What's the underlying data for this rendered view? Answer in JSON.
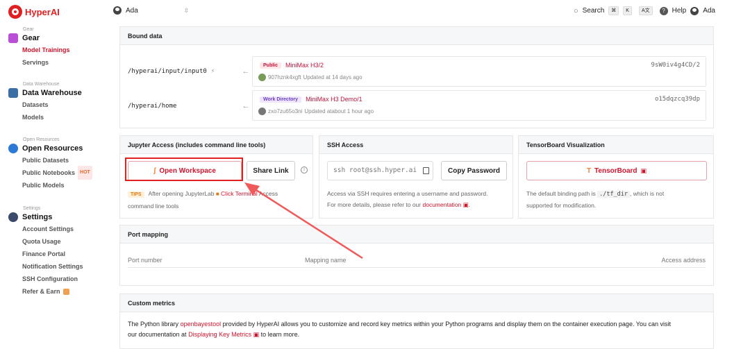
{
  "brand": {
    "name": "HyperAI"
  },
  "topbar": {
    "user": "Ada",
    "search_label": "Search",
    "kbd_cmd": "⌘",
    "kbd_k": "K",
    "help_label": "Help",
    "right_user": "Ada"
  },
  "sidebar": {
    "gear": {
      "small": "Gear",
      "title": "Gear",
      "items": [
        "Model Trainings",
        "Servings"
      ]
    },
    "warehouse": {
      "small": "Data Warehouse",
      "title": "Data Warehouse",
      "items": [
        "Datasets",
        "Models"
      ]
    },
    "resources": {
      "small": "Open Resources",
      "title": "Open Resources",
      "items": [
        "Public Datasets",
        "Public Notebooks",
        "Public Models"
      ],
      "hot": "HOT"
    },
    "settings": {
      "small": "Settings",
      "title": "Settings",
      "items": [
        "Account Settings",
        "Quota Usage",
        "Finance Portal",
        "Notification Settings",
        "SSH Configuration",
        "Refer & Earn"
      ]
    }
  },
  "bound": {
    "title": "Bound data",
    "rows": [
      {
        "path": "/hyperai/input/input0",
        "tag": "Public",
        "name": "MiniMax H3/2",
        "hash": "9sW0iv4g4CD/2",
        "user": "907hznk4xgft",
        "updated": "Updated at 14 days ago"
      },
      {
        "path": "/hyperai/home",
        "tag": "Work Directory",
        "name": "MiniMax H3 Demo/1",
        "hash": "o15dqzcq39dp",
        "user": "zxo7zu65o3ni",
        "updated": "Updated atabout 1 hour ago"
      }
    ]
  },
  "jupyter": {
    "title": "Jupyter Access (includes command line tools)",
    "open_label": "Open Workspace",
    "share_label": "Share Link",
    "tips_label": "TIPS",
    "tip_text_1": "After opening JupyterLab",
    "tip_link": "Click Terminal",
    "tip_text_2": "Access",
    "tip_text_3": "command line tools"
  },
  "ssh": {
    "title": "SSH Access",
    "command": "ssh root@ssh.hyper.ai",
    "copy_label": "Copy Password",
    "desc_1": "Access via SSH requires entering a username and password.",
    "desc_2": "For more details, please refer to our",
    "doc_link": "documentation"
  },
  "tensorboard": {
    "title": "TensorBoard Visualization",
    "button_label": "TensorBoard",
    "desc_1": "The default binding path is",
    "path": "./tf_dir",
    "desc_2": ", which is not",
    "desc_3": "supported for modification."
  },
  "ports": {
    "title": "Port mapping",
    "col_port": "Port number",
    "col_mapping": "Mapping name",
    "col_access": "Access address"
  },
  "metrics": {
    "title": "Custom metrics",
    "text_1": "The Python library",
    "lib_link": "openbayestool",
    "text_2": "provided by HyperAI allows you to customize and record key metrics within your Python programs and display them on the container execution page. You can visit",
    "text_3": "our documentation at",
    "doc_link": "Displaying Key Metrics",
    "text_4": "to learn more."
  },
  "colors": {
    "accent": "#d0142c",
    "brand": "#e02020"
  }
}
